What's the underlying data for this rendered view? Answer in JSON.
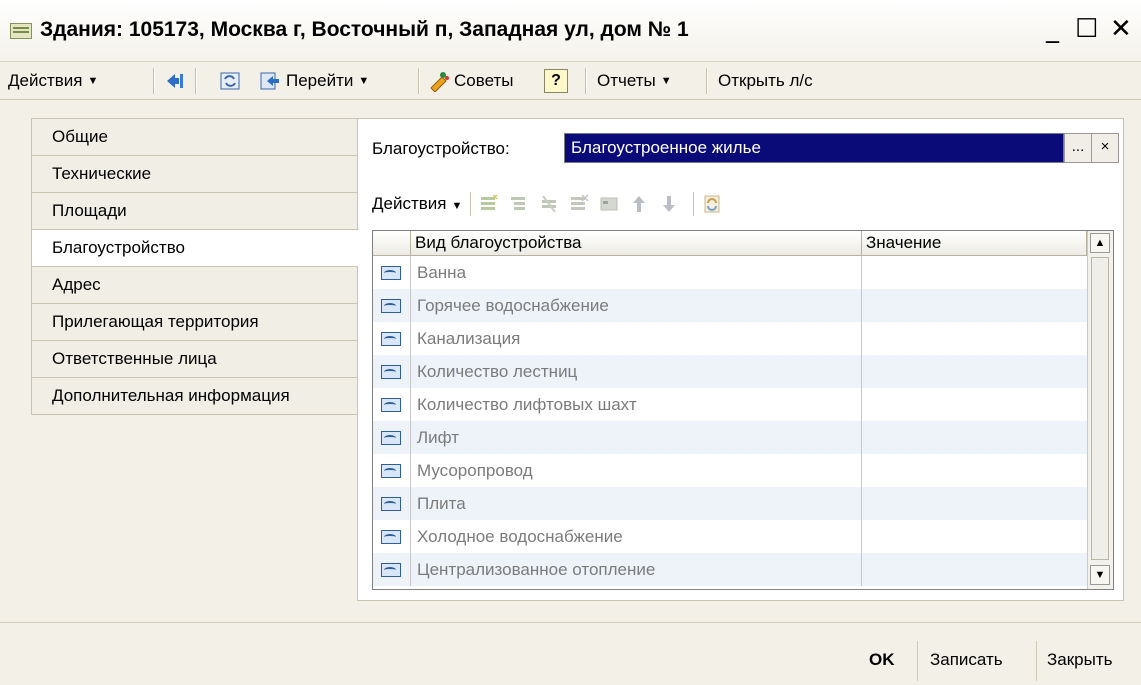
{
  "window": {
    "title": "Здания: 105173, Москва г, Восточный п, Западная ул, дом № 1",
    "minimize": "_",
    "maximize": "☐",
    "close": "✕"
  },
  "toolbar": {
    "actions": "Действия",
    "goto": "Перейти",
    "tips": "Советы",
    "help": "?",
    "reports": "Отчеты",
    "open_account": "Открыть л/с"
  },
  "tabs": [
    {
      "label": "Общие"
    },
    {
      "label": "Технические"
    },
    {
      "label": "Площади"
    },
    {
      "label": "Благоустройство",
      "active": true
    },
    {
      "label": "Адрес"
    },
    {
      "label": "Прилегающая территория"
    },
    {
      "label": "Ответственные лица"
    },
    {
      "label": "Дополнительная информация"
    }
  ],
  "panel": {
    "field_label": "Благоустройство:",
    "field_value": "Благоустроенное жилье",
    "select_button": "...",
    "clear_button": "×",
    "actions": "Действия"
  },
  "table": {
    "columns": [
      "Вид благоустройства",
      "Значение"
    ],
    "rows": [
      {
        "type": "Ванна",
        "value": ""
      },
      {
        "type": "Горячее водоснабжение",
        "value": ""
      },
      {
        "type": "Канализация",
        "value": ""
      },
      {
        "type": "Количество лестниц",
        "value": ""
      },
      {
        "type": "Количество лифтовых шахт",
        "value": ""
      },
      {
        "type": "Лифт",
        "value": ""
      },
      {
        "type": "Мусоропровод",
        "value": ""
      },
      {
        "type": "Плита",
        "value": ""
      },
      {
        "type": "Холодное водоснабжение",
        "value": ""
      },
      {
        "type": "Централизованное отопление",
        "value": ""
      }
    ]
  },
  "footer": {
    "ok": "OK",
    "save": "Записать",
    "close": "Закрыть"
  },
  "colors": {
    "selection": "#0a0a78",
    "row_alt": "#eef3fa",
    "row_text": "#7b7b7b"
  }
}
